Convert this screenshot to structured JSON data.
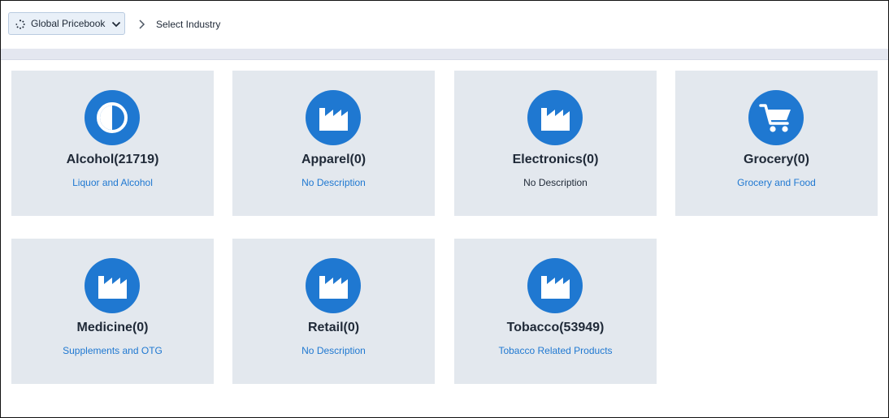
{
  "header": {
    "pricebook_label": "Global Pricebook",
    "pricebook_icon": "spinner-icon",
    "breadcrumb_current": "Select Industry"
  },
  "industries": [
    {
      "title": "Alcohol(21719)",
      "description": "Liquor and Alcohol",
      "icon": "contrast-icon"
    },
    {
      "title": "Apparel(0)",
      "description": "No Description",
      "icon": "factory-icon"
    },
    {
      "title": "Electronics(0)",
      "description": "No Description",
      "icon": "factory-icon"
    },
    {
      "title": "Grocery(0)",
      "description": "Grocery and Food",
      "icon": "cart-icon"
    },
    {
      "title": "Medicine(0)",
      "description": "Supplements and OTG",
      "icon": "factory-icon"
    },
    {
      "title": "Retail(0)",
      "description": "No Description",
      "icon": "factory-icon"
    },
    {
      "title": "Tobacco(53949)",
      "description": "Tobacco Related Products",
      "icon": "factory-icon"
    }
  ],
  "colors": {
    "accent": "#1f78d1",
    "card_bg": "#e3e8ee",
    "band": "#e4e7f0"
  }
}
